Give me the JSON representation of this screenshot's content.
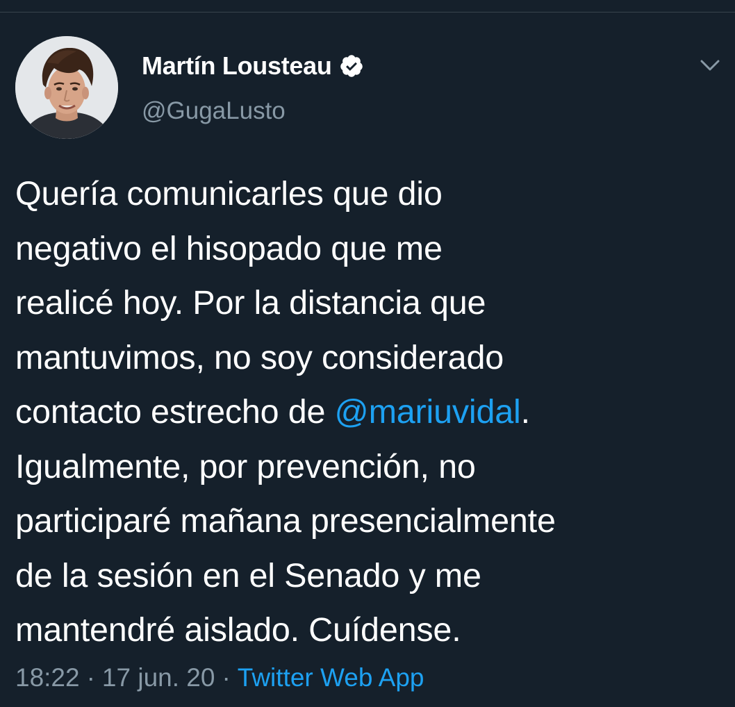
{
  "colors": {
    "background": "#15202b",
    "primary_text": "#ffffff",
    "secondary_text": "#8899a6",
    "link": "#1da1f2",
    "divider": "#38444d"
  },
  "author": {
    "display_name": "Martín Lousteau",
    "handle": "@GugaLusto",
    "verified": true,
    "verified_icon": "verified-badge-icon",
    "avatar": "profile-photo"
  },
  "menu": {
    "icon": "chevron-down-icon"
  },
  "tweet": {
    "lines": [
      {
        "text": "Quería comunicarles que dio"
      },
      {
        "text": "negativo el hisopado que me"
      },
      {
        "text": "realicé hoy. Por la distancia que"
      },
      {
        "text": "mantuvimos, no soy considerado"
      },
      {
        "before": "contacto estrecho de ",
        "mention": "@mariuvidal",
        "after": "."
      },
      {
        "text": "Igualmente, por prevención, no"
      },
      {
        "text": "participaré mañana presencialmente"
      },
      {
        "text": "de la sesión en el Senado y me"
      },
      {
        "text": "mantendré aislado. Cuídense."
      }
    ]
  },
  "meta": {
    "time": "18:22",
    "separator": "·",
    "date": "17 jun. 20",
    "source": "Twitter Web App"
  }
}
